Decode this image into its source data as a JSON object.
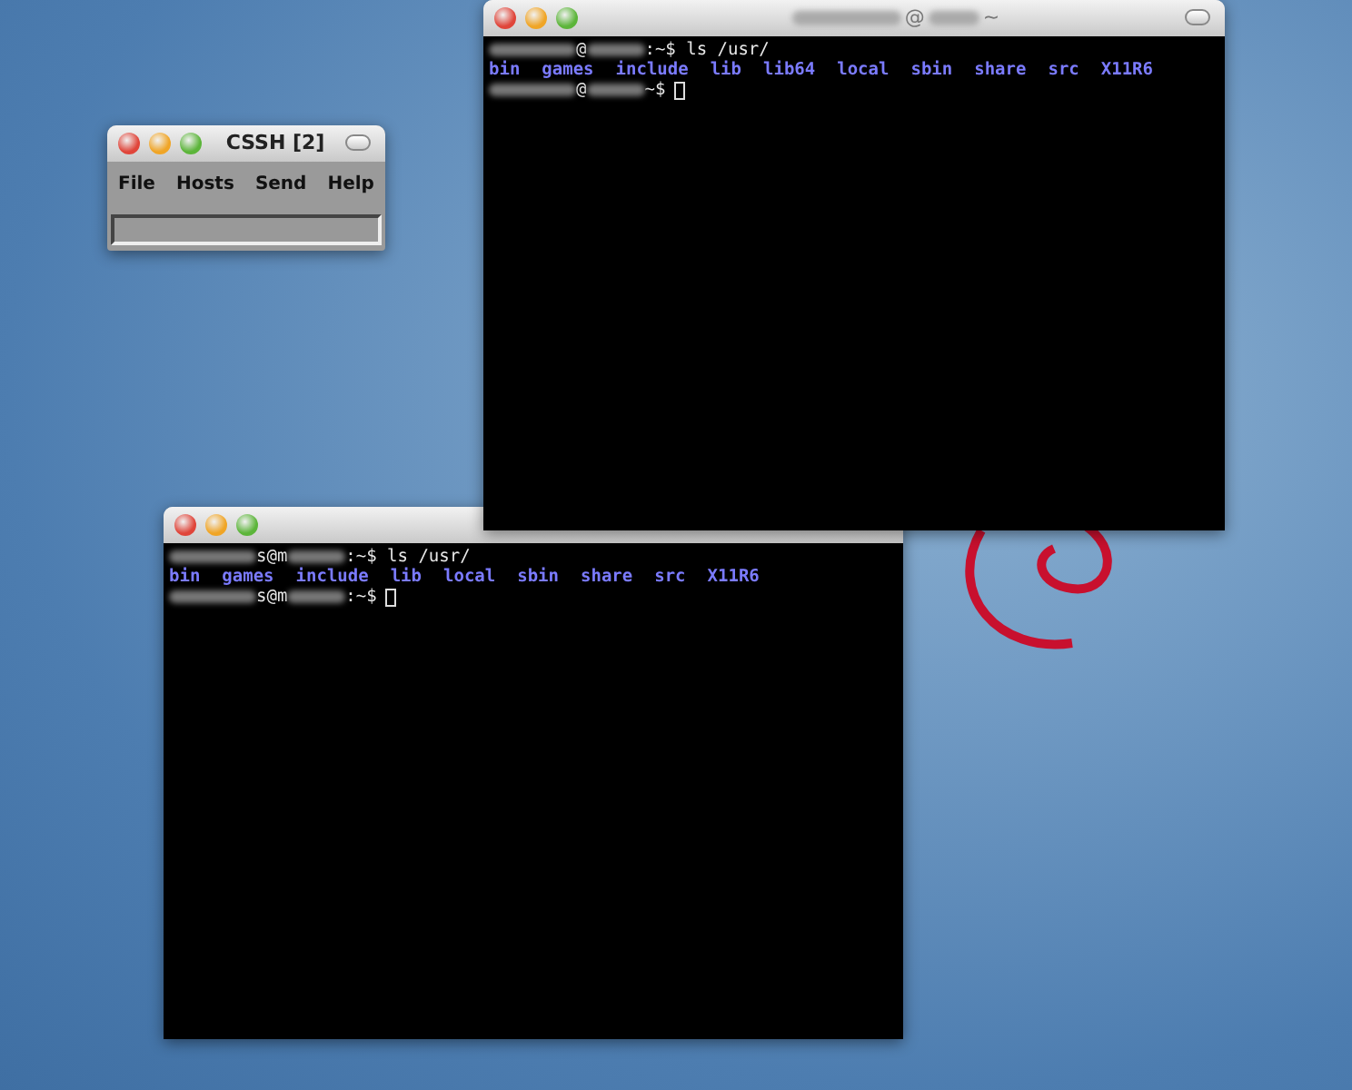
{
  "cssh_window": {
    "title": "CSSH [2]",
    "menu": [
      "File",
      "Hosts",
      "Send",
      "Help"
    ]
  },
  "terminals": [
    {
      "title": [
        {
          "kind": "blur"
        },
        {
          "kind": "text",
          "text": "@"
        },
        {
          "kind": "blur"
        },
        {
          "kind": "text",
          "text": "~"
        }
      ],
      "lines": [
        [
          {
            "kind": "blur"
          },
          {
            "kind": "text",
            "text": "@"
          },
          {
            "kind": "blur"
          },
          {
            "kind": "text",
            "text": ":~$ ls /usr/"
          }
        ],
        [
          {
            "kind": "entry",
            "text": "bin"
          },
          {
            "kind": "entry",
            "text": "games"
          },
          {
            "kind": "entry",
            "text": "include"
          },
          {
            "kind": "entry",
            "text": "lib"
          },
          {
            "kind": "entry",
            "text": "lib64"
          },
          {
            "kind": "entry",
            "text": "local"
          },
          {
            "kind": "entry",
            "text": "sbin"
          },
          {
            "kind": "entry",
            "text": "share"
          },
          {
            "kind": "entry",
            "text": "src"
          },
          {
            "kind": "entry",
            "text": "X11R6"
          }
        ],
        [
          {
            "kind": "blur"
          },
          {
            "kind": "text",
            "text": "@"
          },
          {
            "kind": "blur"
          },
          {
            "kind": "text",
            "text": "~$"
          },
          {
            "kind": "cursor"
          }
        ]
      ]
    },
    {
      "lines": [
        [
          {
            "kind": "blur"
          },
          {
            "kind": "text",
            "text": "s@m"
          },
          {
            "kind": "blur"
          },
          {
            "kind": "text",
            "text": ":~$ ls /usr/"
          }
        ],
        [
          {
            "kind": "entry",
            "text": "bin"
          },
          {
            "kind": "entry",
            "text": "games"
          },
          {
            "kind": "entry",
            "text": "include"
          },
          {
            "kind": "entry",
            "text": "lib"
          },
          {
            "kind": "entry",
            "text": "local"
          },
          {
            "kind": "entry",
            "text": "sbin"
          },
          {
            "kind": "entry",
            "text": "share"
          },
          {
            "kind": "entry",
            "text": "src"
          },
          {
            "kind": "entry",
            "text": "X11R6"
          }
        ],
        [
          {
            "kind": "blur"
          },
          {
            "kind": "text",
            "text": "s@m"
          },
          {
            "kind": "blur"
          },
          {
            "kind": "text",
            "text": ":~$"
          },
          {
            "kind": "cursor"
          }
        ]
      ]
    }
  ]
}
